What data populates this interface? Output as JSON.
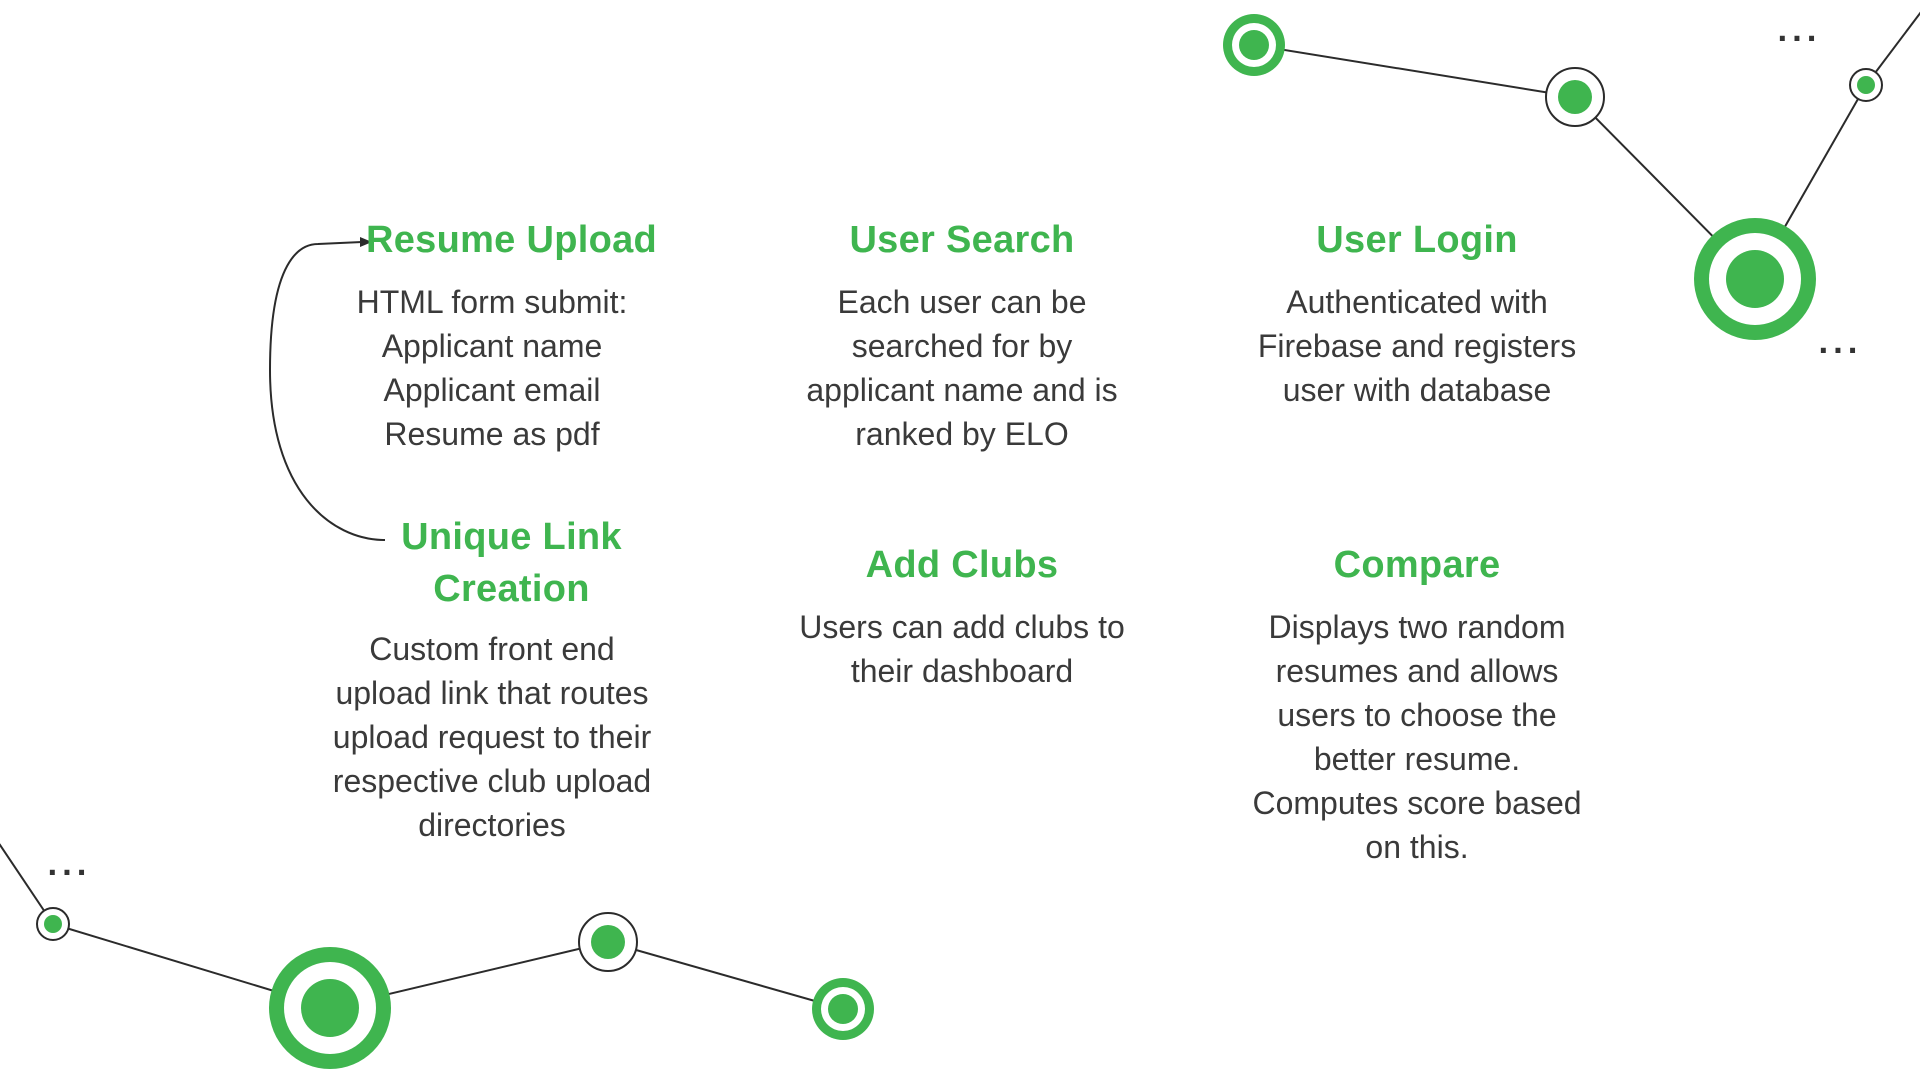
{
  "colors": {
    "accent": "#3fb54f",
    "line": "#2b2b2b",
    "text": "#3a3a3a",
    "background": "#ffffff"
  },
  "features": [
    {
      "id": "resume-upload",
      "title": "Resume Upload",
      "description": "HTML form submit:\nApplicant name\nApplicant email\nResume as pdf"
    },
    {
      "id": "user-search",
      "title": "User Search",
      "description": "Each user can be\nsearched for by\napplicant name and is\nranked by ELO"
    },
    {
      "id": "user-login",
      "title": "User Login",
      "description": "Authenticated with\nFirebase and registers\nuser with database"
    },
    {
      "id": "unique-link-creation",
      "title": "Unique Link\nCreation",
      "description": "Custom front end\nupload link that routes\nupload request to their\nrespective club upload\ndirectories"
    },
    {
      "id": "add-clubs",
      "title": "Add Clubs",
      "description": "Users can add clubs to\ntheir dashboard"
    },
    {
      "id": "compare",
      "title": "Compare",
      "description": "Displays two random\nresumes and allows\nusers to choose the\nbetter resume.\nComputes score based\non this."
    }
  ],
  "ellipsis": "..."
}
